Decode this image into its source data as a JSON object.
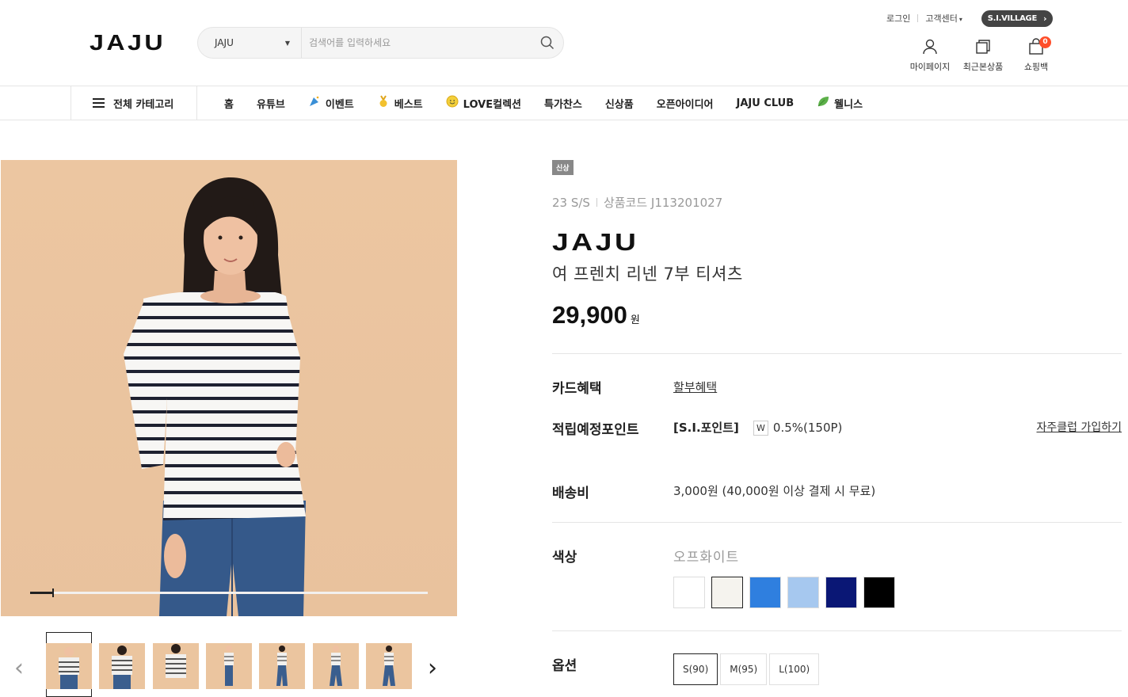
{
  "header": {
    "logo": "JAJU",
    "search": {
      "scope": "JAJU",
      "placeholder": "검색어를 입력하세요"
    },
    "util": {
      "login": "로그인",
      "customer_center": "고객센터",
      "customer_center_caret": "▾",
      "sivillage": "S.I.VILLAGE"
    },
    "icons": [
      {
        "label": "마이페이지",
        "icon": "person-icon"
      },
      {
        "label": "최근본상품",
        "icon": "recent-icon"
      },
      {
        "label": "쇼핑백",
        "icon": "bag-icon",
        "badge": "0"
      }
    ]
  },
  "nav": {
    "all_category": "전체 카테고리",
    "items": [
      "홈",
      "유튜브",
      "이벤트",
      "베스트",
      "LOVE컬렉션",
      "특가찬스",
      "신상품",
      "오픈아이디어",
      "JAJU CLUB",
      "웰니스"
    ]
  },
  "gallery": {
    "thumb_count": 7,
    "progress": 0.06
  },
  "product": {
    "tag": "신상",
    "season": "23 S/S",
    "code": "상품코드 J113201027",
    "brand": "JAJU",
    "name": "여 프렌치 리넨 7부 티셔츠",
    "price": "29,900",
    "price_unit": "원",
    "card_label": "카드혜택",
    "card_value": "할부혜택",
    "point_label": "적립예정포인트",
    "point_name": "[S.I.포인트]",
    "point_w": "W",
    "point_value": "0.5%(150P)",
    "club_link": "자주클럽 가입하기",
    "ship_label": "배송비",
    "ship_value": "3,000원 (40,000원 이상 결제 시 무료)",
    "color_label": "색상",
    "color_selected": "오프화이트",
    "colors": [
      "#ffffff",
      "#f5f3ee",
      "#2f7fdf",
      "#a6c8ef",
      "#0a1775",
      "#000000"
    ],
    "option_label": "옵션",
    "sizes": [
      "S(90)",
      "M(95)",
      "L(100)"
    ]
  }
}
